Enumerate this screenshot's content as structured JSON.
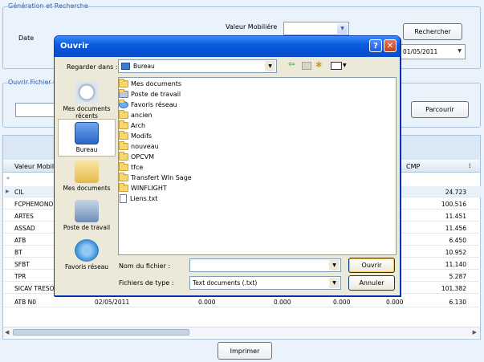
{
  "search_group": {
    "legend": "Génération et Recherche",
    "date_label": "Date",
    "valeur_label": "Valeur Mobiliére",
    "search_button": "Rechercher",
    "date_value": "01/05/2011"
  },
  "file_group": {
    "legend": "Ouvrir Fichier C",
    "browse_button": "Parcourir"
  },
  "grid": {
    "col_valeur": "Valeur Mobilie",
    "col_cmp": "CMP",
    "rows": [
      {
        "name": "CIL",
        "cmp": "24.723"
      },
      {
        "name": "FCPHEMONO",
        "cmp": "100.516"
      },
      {
        "name": "ARTES",
        "cmp": "11.451"
      },
      {
        "name": "ASSAD",
        "cmp": "11.456"
      },
      {
        "name": "ATB",
        "cmp": "6.450"
      },
      {
        "name": "BT",
        "cmp": "10.952"
      },
      {
        "name": "SFBT",
        "cmp": "11.140"
      },
      {
        "name": "TPR",
        "cmp": "5.287"
      },
      {
        "name": "SICAV TRESO",
        "cmp": "101.382"
      }
    ],
    "last_row": {
      "name": "ATB N0",
      "date": "02/05/2011",
      "v1": "0.000",
      "v2": "0.000",
      "v3": "0.000",
      "v4": "0.000",
      "cmp": "6.130"
    }
  },
  "print_button": "Imprimer",
  "dialog": {
    "title": "Ouvrir",
    "look_in_label": "Regarder dans :",
    "look_in_value": "Bureau",
    "places": [
      {
        "label": "Mes documents récents"
      },
      {
        "label": "Bureau"
      },
      {
        "label": "Mes documents"
      },
      {
        "label": "Poste de travail"
      },
      {
        "label": "Favoris réseau"
      }
    ],
    "files": [
      "Mes documents",
      "Poste de travail",
      "Favoris réseau",
      "ancien",
      "Arch",
      "Modifs",
      "nouveau",
      "OPCVM",
      "tfce",
      "Transfert WIn Sage",
      "WINFLIGHT",
      "Liens.txt"
    ],
    "filename_label": "Nom du fichier :",
    "filetype_label": "Fichiers de type :",
    "filetype_value": "Text documents (.txt)",
    "open_button": "Ouvrir",
    "cancel_button": "Annuler"
  }
}
